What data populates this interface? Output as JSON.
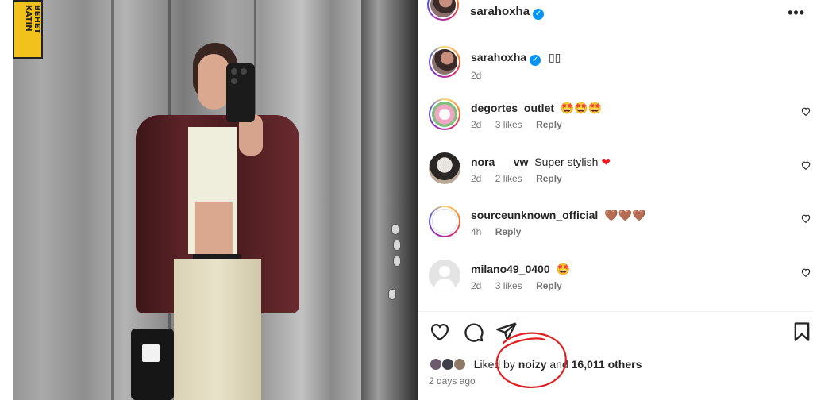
{
  "post": {
    "author": "sarahoxha",
    "verified_mark": "✓",
    "more_icon": "•••"
  },
  "caption": {
    "username": "sarahoxha",
    "text": "▯▯",
    "age": "2d"
  },
  "comments": [
    {
      "username": "degortes_outlet",
      "text": "🤩🤩🤩",
      "age": "2d",
      "likes": "3 likes",
      "reply": "Reply"
    },
    {
      "username": "nora___vw",
      "text": "Super stylish ❤",
      "age": "2d",
      "likes": "2 likes",
      "reply": "Reply"
    },
    {
      "username": "sourceunknown_official",
      "text": "🤎🤎🤎",
      "age": "4h",
      "likes": "",
      "reply": "Reply"
    },
    {
      "username": "milano49_0400",
      "text": "🤩",
      "age": "2d",
      "likes": "3 likes",
      "reply": "Reply"
    }
  ],
  "actions": {
    "like_icon": "heart-outline-icon",
    "comment_icon": "comment-bubble-icon",
    "share_icon": "paper-plane-icon",
    "save_icon": "bookmark-icon"
  },
  "likes": {
    "prefix": "Liked by",
    "user": "noizy",
    "middle": "and",
    "count": "16,011 others"
  },
  "timestamp": "2 days ago",
  "photo_sticker_text": "BEHET KATIN",
  "colors": {
    "verified_blue": "#0095f6",
    "red_heart": "#ed1c24",
    "annotation_red": "#e02020",
    "muted_text": "#737373"
  }
}
